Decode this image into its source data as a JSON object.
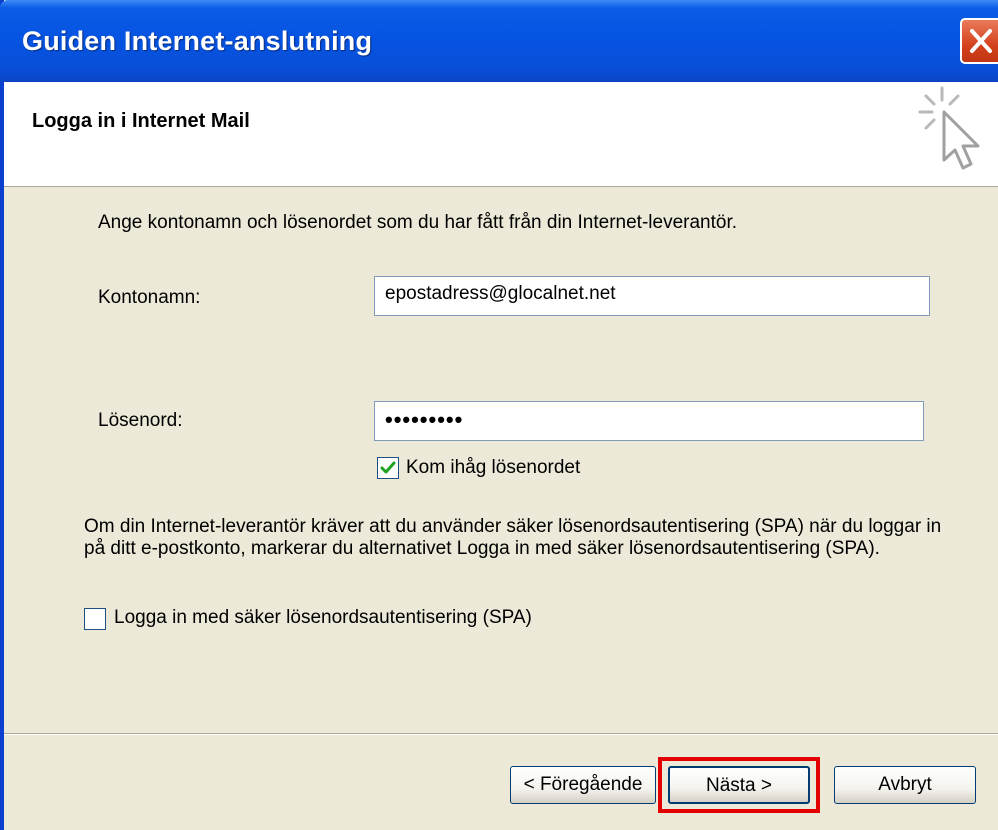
{
  "window": {
    "title": "Guiden Internet-anslutning"
  },
  "header": {
    "title": "Logga in i Internet Mail"
  },
  "form": {
    "instruction": "Ange kontonamn och lösenordet som du har fått från din Internet-leverantör.",
    "account_label": "Kontonamn:",
    "account_value": "epostadress@glocalnet.net",
    "password_label": "Lösenord:",
    "password_mask": "•••••••••",
    "remember_label": "Kom ihåg lösenordet",
    "remember_checked": true,
    "spa_description": "Om din Internet-leverantör kräver att du använder säker lösenordsautentisering (SPA) när du loggar in på ditt e-postkonto, markerar du alternativet Logga in med säker lösenordsautentisering (SPA).",
    "spa_label": "Logga in med säker lösenordsautentisering (SPA)",
    "spa_checked": false
  },
  "buttons": {
    "back": "< Föregående",
    "next": "Nästa >",
    "cancel": "Avbryt"
  },
  "colors": {
    "titlebar": "#0553e1",
    "highlight": "#e30000",
    "checkmark": "#21a121"
  },
  "icons": {
    "close": "close-icon",
    "wizard": "cursor-sparkle-icon"
  }
}
